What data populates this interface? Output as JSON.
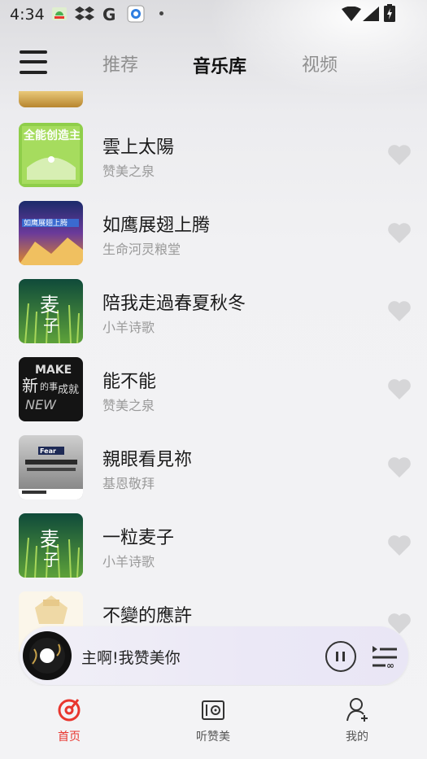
{
  "status_bar": {
    "time": "4:34",
    "icons": [
      "android-icon",
      "dropbox-icon",
      "google-icon",
      "app-icon",
      "dot-icon",
      "wifi-icon",
      "signal-icon",
      "battery-icon"
    ]
  },
  "header": {
    "tabs": [
      {
        "label": "推荐",
        "active": false
      },
      {
        "label": "音乐库",
        "active": true
      },
      {
        "label": "视频",
        "active": false
      }
    ]
  },
  "songs": [
    {
      "title": "雲上太陽",
      "artist": "赞美之泉",
      "cover": "green"
    },
    {
      "title": "如鹰展翅上腾",
      "artist": "生命河灵粮堂",
      "cover": "colorful"
    },
    {
      "title": "陪我走過春夏秋冬",
      "artist": "小羊诗歌",
      "cover": "wheat"
    },
    {
      "title": "能不能",
      "artist": "赞美之泉",
      "cover": "dark"
    },
    {
      "title": "親眼看見祢",
      "artist": "基恩敬拜",
      "cover": "grey"
    },
    {
      "title": "一粒麦子",
      "artist": "小羊诗歌",
      "cover": "wheat"
    },
    {
      "title": "不變的應許",
      "artist": "",
      "cover": "light"
    }
  ],
  "player": {
    "now_playing": "主啊!我赞美你"
  },
  "bottom_nav": [
    {
      "label": "首页",
      "active": true
    },
    {
      "label": "听赞美",
      "active": false
    },
    {
      "label": "我的",
      "active": false
    }
  ],
  "colors": {
    "accent": "#e8362e",
    "heart": "#d6d6d8",
    "text_primary": "#1a1a1a",
    "text_secondary": "#9a9a9a"
  }
}
